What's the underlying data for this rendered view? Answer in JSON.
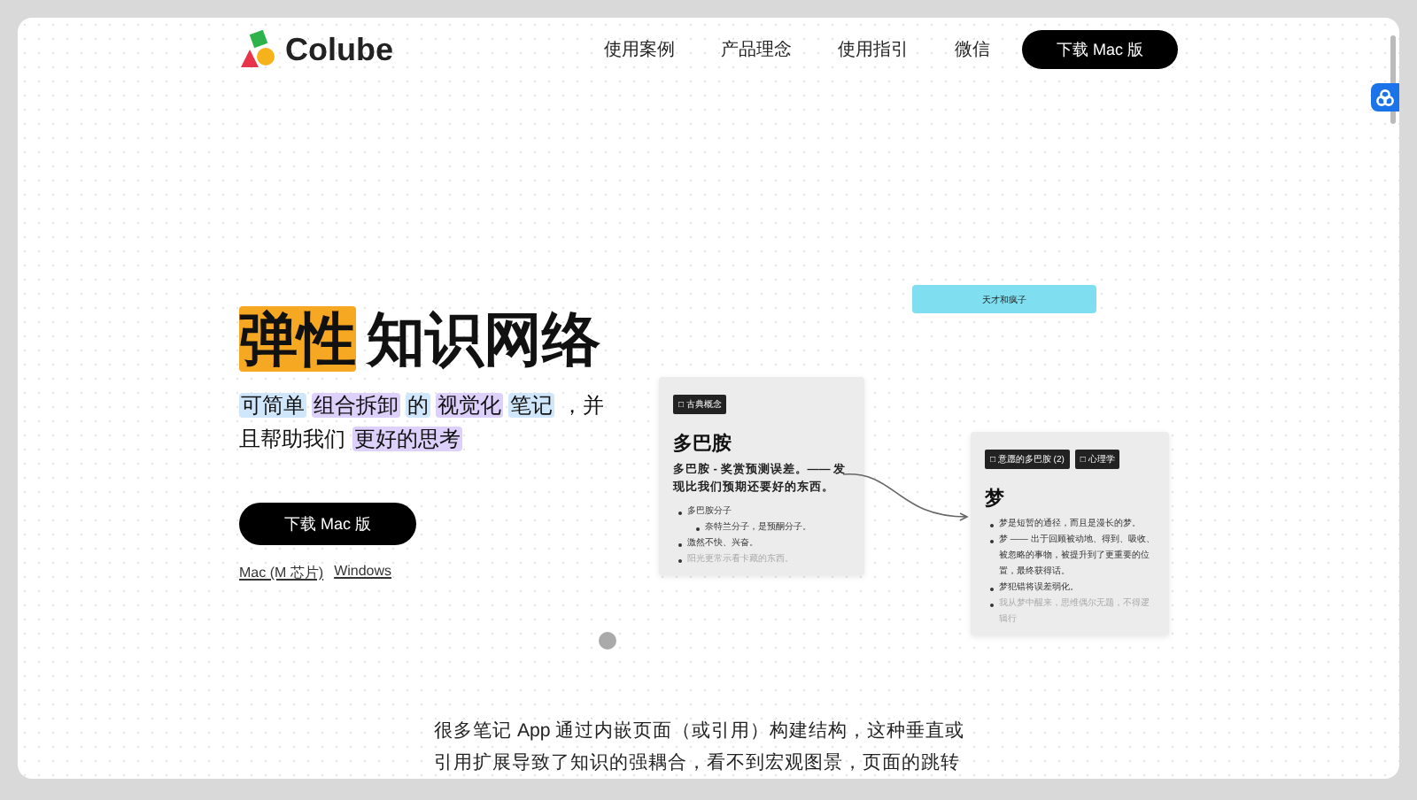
{
  "nav": {
    "brand": "Colube",
    "links": [
      "使用案例",
      "产品理念",
      "使用指引",
      "微信"
    ],
    "cta": "下载 Mac 版"
  },
  "hero": {
    "title": [
      {
        "text": "弹性",
        "color": "#f7a823"
      },
      {
        "text": "知识网络"
      }
    ],
    "subtitle": [
      {
        "text": "可简单",
        "color": "#cfe6fb"
      },
      {
        "text": "组合拆卸",
        "color": "#ddd0fb"
      },
      {
        "text": "的",
        "color": "#cfe6fb"
      },
      {
        "text": "视觉化",
        "color": "#ddd0fb"
      },
      {
        "text": "笔记",
        "color": "#cfe6fb"
      },
      {
        "text": "，并且帮助我们"
      },
      {
        "text": "更好的思考",
        "color": "#ddd0fb"
      }
    ],
    "download": "下载 Mac 版",
    "links": [
      "Mac (M 芯片)",
      "Windows"
    ]
  },
  "canvas": {
    "banner": "天才和疯子",
    "cards": [
      {
        "tags": [
          "□ 古典概念"
        ],
        "title": "多巴胺",
        "lead": "多巴胺 - 奖赏预测误差。—— 发现比我们预期还要好的东西。",
        "bullets": [
          {
            "text": "多巴胺分子",
            "faded": false,
            "children": [
              {
                "text": "奈特兰分子，是预酮分子。",
                "faded": false
              }
            ]
          },
          {
            "text": "激然不快、兴奋。",
            "faded": false
          },
          {
            "text": "阳光更常示看卡藏的东西。",
            "faded": true
          }
        ]
      },
      {
        "tags": [
          "□ 意愿的多巴胺 (2)",
          "□ 心理学"
        ],
        "title": "梦",
        "bullets": [
          {
            "text": "梦是短暂的通径，而且是漫长的梦。",
            "faded": false
          },
          {
            "text": "梦 —— 出于回顾被动地、得到、吸收、被忽略的事物，被提升到了更重要的位置，最终获得话。",
            "faded": false
          },
          {
            "text": "梦犯错将误差弱化。",
            "faded": false
          },
          {
            "text": "我从梦中醒来，思维偶尔无题，不得逻辑行",
            "faded": true
          }
        ]
      }
    ]
  },
  "intro": "很多笔记 App 通过内嵌页面（或引用）构建结构，这种垂直或引用扩展导致了知识的强耦合，看不到宏观图景，页面的跳转"
}
